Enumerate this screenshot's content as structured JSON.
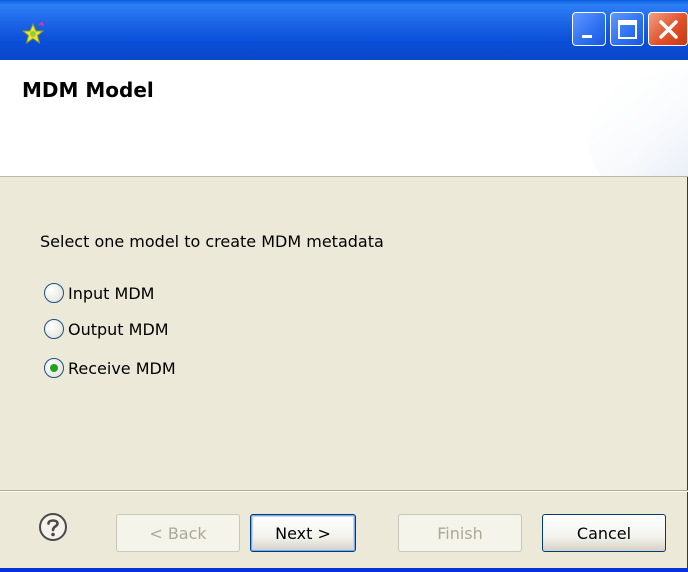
{
  "window": {
    "icon": "wizard-star-icon",
    "controls": {
      "minimize": "minimize-icon",
      "maximize": "maximize-icon",
      "close": "close-icon"
    }
  },
  "banner": {
    "title": "MDM Model"
  },
  "content": {
    "prompt": "Select one model to create MDM metadata",
    "options": [
      {
        "label": "Input MDM",
        "checked": false
      },
      {
        "label": "Output MDM",
        "checked": false
      },
      {
        "label": "Receive MDM",
        "checked": true
      }
    ]
  },
  "footer": {
    "help_icon": "help-icon",
    "back_label": "< Back",
    "next_label": "Next >",
    "finish_label": "Finish",
    "cancel_label": "Cancel"
  },
  "colors": {
    "titlebar": "#1b63e6",
    "dialog_bg": "#ece9d8",
    "radio_selected": "#21a121",
    "close_button": "#e2512b"
  }
}
